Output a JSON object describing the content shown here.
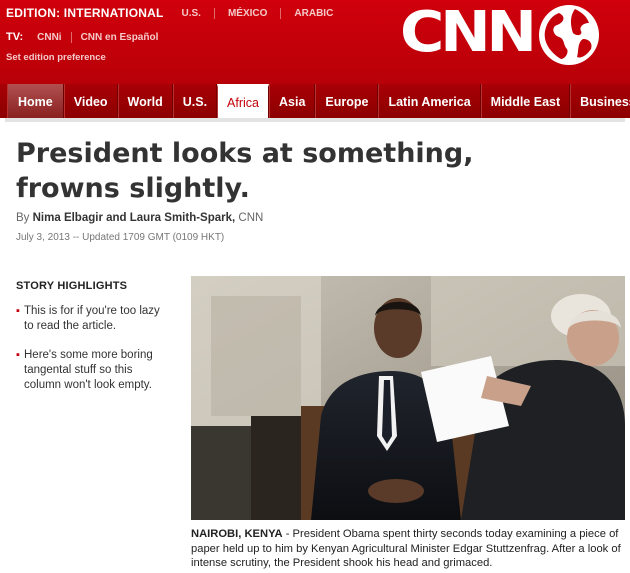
{
  "header": {
    "edition_label": "EDITION:  INTERNATIONAL",
    "editions": [
      "U.S.",
      "MÉXICO",
      "ARABIC"
    ],
    "tv_label": "TV:",
    "tv_links": [
      "CNNi",
      "CNN en Español"
    ],
    "set_edition": "Set edition preference",
    "logo": "CNN",
    "brand_color": "#c4000a"
  },
  "nav": {
    "items": [
      "Home",
      "Video",
      "World",
      "U.S.",
      "Africa",
      "Asia",
      "Europe",
      "Latin America",
      "Middle East",
      "Business"
    ],
    "active": "Africa"
  },
  "article": {
    "headline": "President looks at something, frowns slightly.",
    "byline_prefix": "By ",
    "authors": "Nima Elbagir and Laura Smith-Spark,",
    "source": " CNN",
    "dateline": "July 3, 2013 -- Updated 1709 GMT (0109 HKT)"
  },
  "highlights": {
    "title": "STORY HIGHLIGHTS",
    "items": [
      "This is for if you're too lazy to read the article.",
      "Here's some more boring tangental stuff so this column won't look empty."
    ]
  },
  "caption": {
    "location": "NAIROBI, KENYA",
    "text": " - President Obama spent thirty seconds today examining a piece of paper held up to him by Kenyan Agricultural Minister Edgar Stuttzenfrag. After a look of intense scrutiny, the President shook his head and grimaced."
  }
}
